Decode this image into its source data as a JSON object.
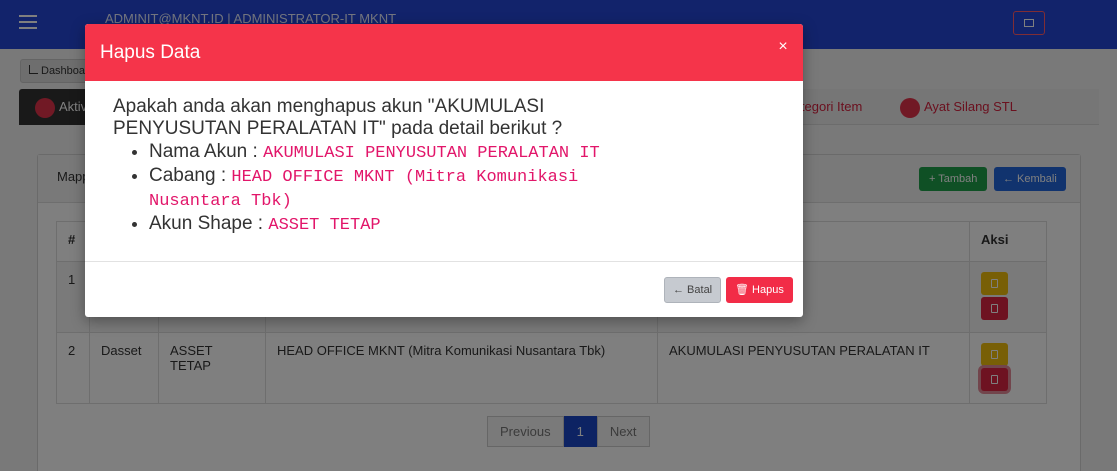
{
  "header": {
    "user_line": "ADMINIT@MKNT.ID | ADMINISTRATOR-IT MKNT"
  },
  "breadcrumb": {
    "label": "Dashboard"
  },
  "tabs": {
    "active_label": "Aktiva",
    "link1_label": "Kategori Item",
    "link2_label": "Ayat Silang STL"
  },
  "card": {
    "title": "Mapping",
    "add_label": "+ Tambah",
    "back_label": "← Kembali"
  },
  "table": {
    "headers": {
      "no": "#",
      "aksi": "Aksi"
    },
    "rows": [
      {
        "no": "1",
        "kode": "",
        "akun_shape": "",
        "cabang": "",
        "nama_akun": ""
      },
      {
        "no": "2",
        "kode": "Dasset",
        "akun_shape": "ASSET TETAP",
        "cabang": "HEAD OFFICE MKNT (Mitra Komunikasi Nusantara Tbk)",
        "nama_akun": "AKUMULASI PENYUSUTAN PERALATAN IT"
      }
    ]
  },
  "pagination": {
    "previous": "Previous",
    "current": "1",
    "next": "Next"
  },
  "modal": {
    "title": "Hapus Data",
    "close_glyph": "×",
    "question": "Apakah anda akan menghapus akun \"AKUMULASI PENYUSUTAN PERALATAN IT\" pada detail berikut ?",
    "details": [
      {
        "label": "Nama Akun : ",
        "value": "AKUMULASI PENYUSUTAN PERALATAN IT"
      },
      {
        "label": "Cabang : ",
        "value": "HEAD OFFICE MKNT (Mitra Komunikasi Nusantara Tbk)"
      },
      {
        "label": "Akun Shape : ",
        "value": "ASSET TETAP"
      }
    ],
    "cancel_label": "← Batal",
    "delete_label": "🗑 Hapus"
  },
  "colors": {
    "topbar": "#2446d6",
    "modal_header": "#f5344a",
    "code_text": "#e2166a",
    "delete_button": "#f22c47"
  }
}
